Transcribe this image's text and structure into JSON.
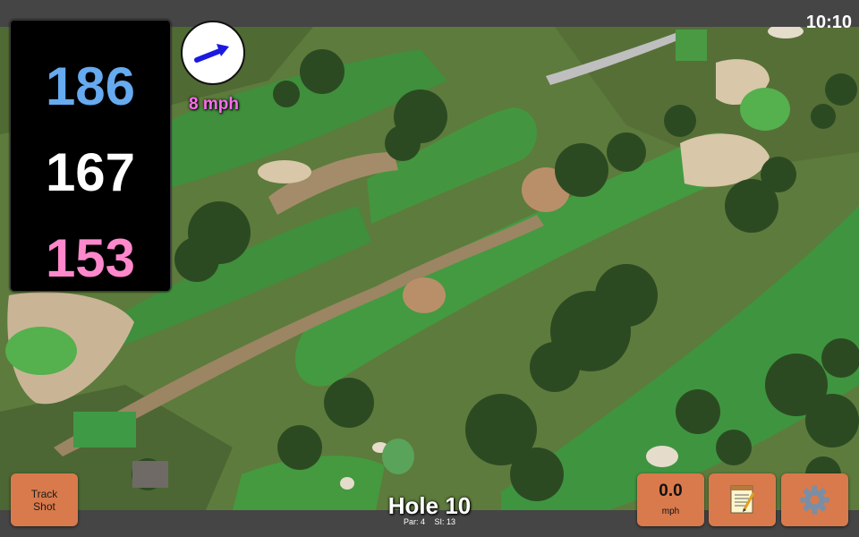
{
  "status_bar": {
    "time": "10:10"
  },
  "distances": {
    "back": "186",
    "middle": "167",
    "front": "153"
  },
  "wind": {
    "speed": "8 mph",
    "direction_icon": "arrow-icon"
  },
  "buttons": {
    "track_shot_line1": "Track",
    "track_shot_line2": "Shot",
    "speed_value": "0.0",
    "speed_unit": "mph",
    "notes_icon": "notepad-icon",
    "settings_icon": "gear-icon"
  },
  "hole": {
    "title": "Hole 10",
    "par": "Par: 4",
    "si": "SI: 13"
  },
  "colors": {
    "back_distance": "#66aaf0",
    "middle_distance": "#ffffff",
    "front_distance": "#ff88cc",
    "wind_text": "#ff6cf0",
    "button": "#d97a4c",
    "bar": "#454545"
  }
}
